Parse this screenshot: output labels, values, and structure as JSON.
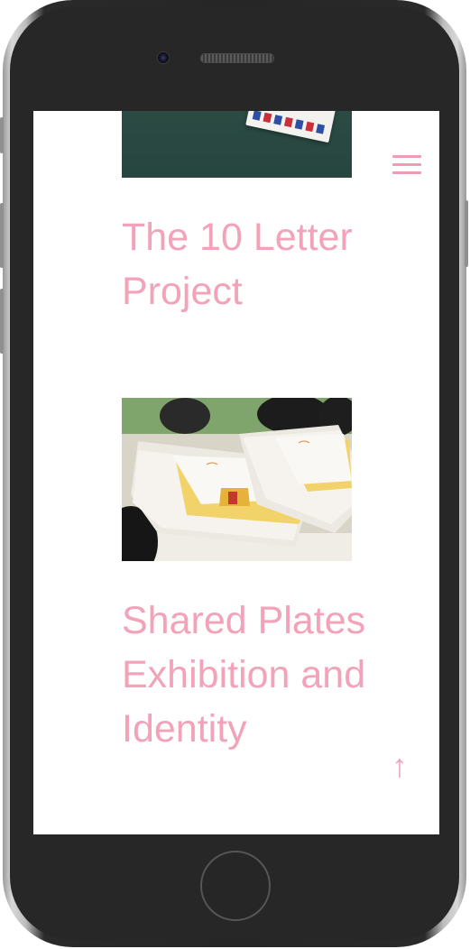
{
  "page": {
    "accent_color": "#f2a3b9",
    "menu_icon": "hamburger-menu-icon",
    "scroll_icon": "up-arrow-icon"
  },
  "posts": [
    {
      "title": "The 10 Letter Project"
    },
    {
      "title": "Shared Plates Exhibition and Identity"
    }
  ],
  "scroll_top": {
    "label": "↑"
  }
}
